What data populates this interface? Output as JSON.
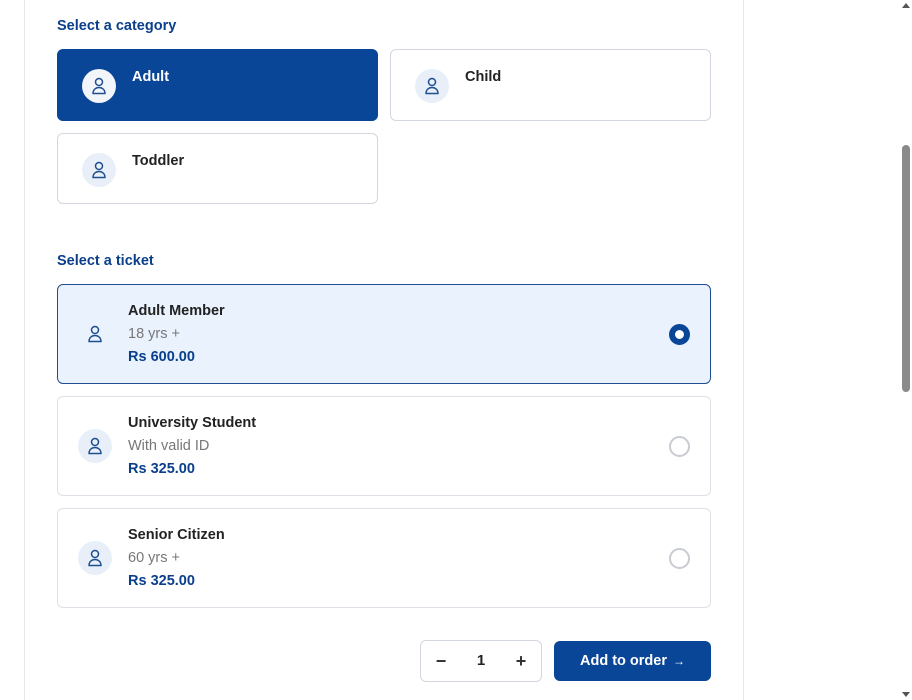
{
  "category_section": {
    "title": "Select a category",
    "options": [
      {
        "label": "Adult",
        "selected": true
      },
      {
        "label": "Child",
        "selected": false
      },
      {
        "label": "Toddler",
        "selected": false
      }
    ]
  },
  "ticket_section": {
    "title": "Select a ticket",
    "tickets": [
      {
        "name": "Adult Member",
        "description": "18 yrs +",
        "price": "Rs 600.00",
        "selected": true
      },
      {
        "name": "University Student",
        "description": "With valid ID",
        "price": "Rs 325.00",
        "selected": false
      },
      {
        "name": "Senior Citizen",
        "description": "60 yrs +",
        "price": "Rs 325.00",
        "selected": false
      }
    ]
  },
  "quantity": {
    "minus_symbol": "−",
    "value": "1",
    "plus_symbol": "+"
  },
  "add_button": {
    "label": "Add to order",
    "arrow": "→"
  },
  "colors": {
    "brand_blue": "#0a4698",
    "heading_blue": "#0b3f8c",
    "selected_ticket_bg": "#e9f2fd"
  },
  "icons": {
    "person": "person-icon"
  }
}
